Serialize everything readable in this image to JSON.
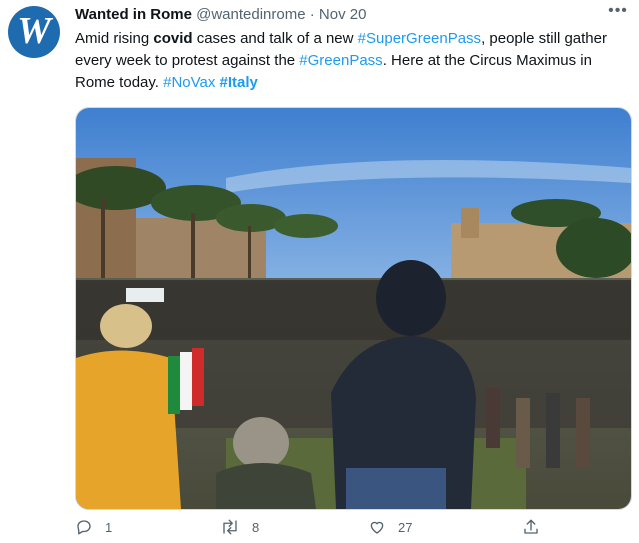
{
  "tweet": {
    "author": {
      "name": "Wanted in Rome",
      "handle": "@wantedinrome",
      "separator": "·",
      "date": "Nov 20",
      "avatar_letter": "W",
      "avatar_color": "#1f6bb0"
    },
    "more_label": "•••",
    "text": {
      "part1": "Amid rising ",
      "bold1": "covid",
      "part2": " cases and talk of a new ",
      "tag1": "#SuperGreenPass",
      "part3": ", people still gather every week to protest against the ",
      "tag2": "#GreenPass",
      "part4": ". Here at the Circus Maximus in Rome today. ",
      "tag3": "#NoVax",
      "part5": " ",
      "tag4": "#Italy"
    },
    "link_color": "#1d9bf0",
    "actions": {
      "reply_count": "1",
      "retweet_count": "8",
      "like_count": "27"
    },
    "icons": [
      "reply-icon",
      "retweet-icon",
      "like-icon",
      "share-icon",
      "more-icon"
    ]
  }
}
